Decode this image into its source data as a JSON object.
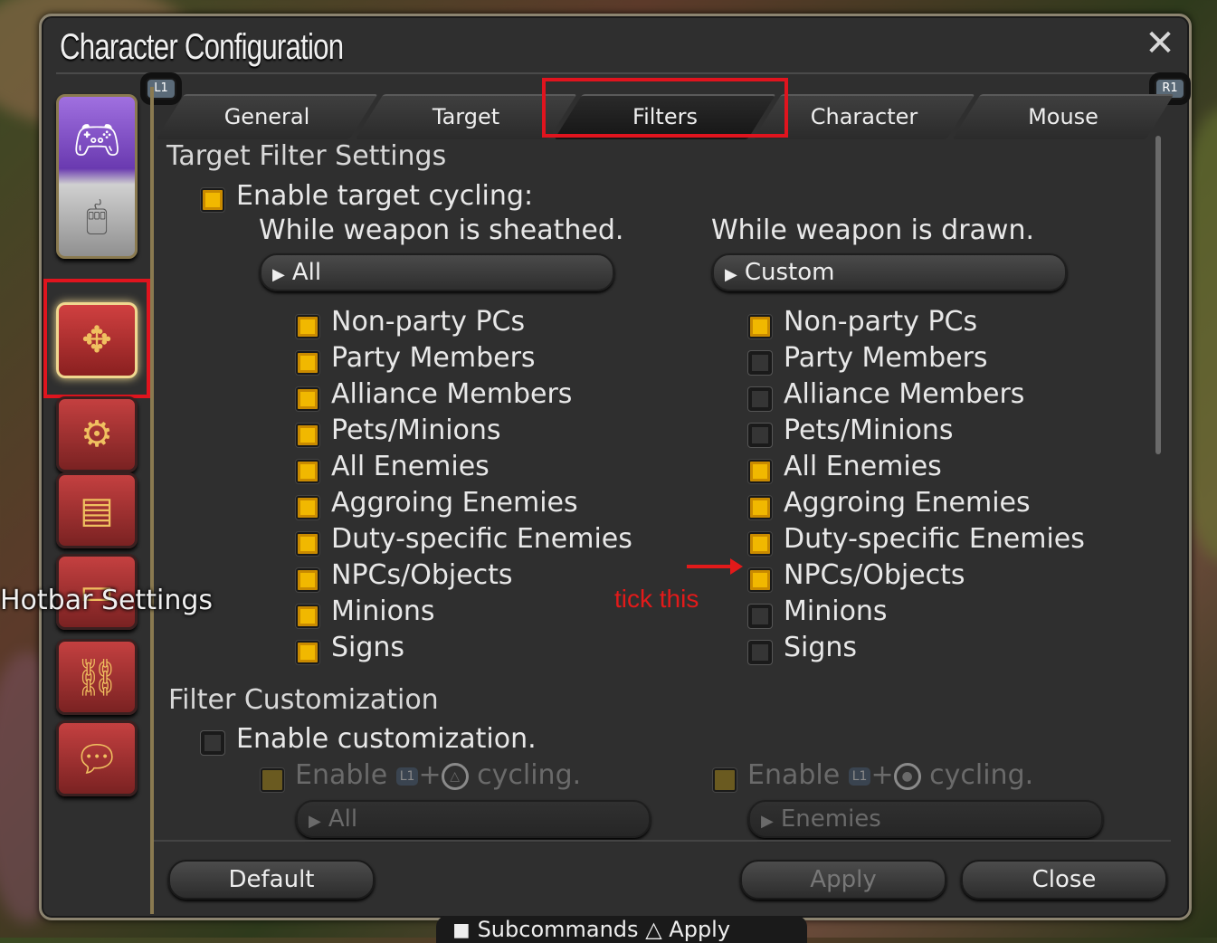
{
  "window": {
    "title": "Character Configuration",
    "close_icon": "close-x-icon"
  },
  "shoulder_buttons": {
    "left": "L1",
    "right": "R1"
  },
  "tabs": [
    {
      "label": "General"
    },
    {
      "label": "Target"
    },
    {
      "label": "Filters",
      "active": true
    },
    {
      "label": "Character"
    },
    {
      "label": "Mouse"
    }
  ],
  "sidebar": {
    "items": [
      {
        "name": "controller-mouse-toggle-icon"
      },
      {
        "name": "target-arrows-icon",
        "selected": true
      },
      {
        "name": "bag-gears-icon"
      },
      {
        "name": "id-card-icon"
      },
      {
        "name": "hotbar-icon",
        "tooltip": "Hotbar Settings"
      },
      {
        "name": "chain-icon"
      },
      {
        "name": "chat-bubble-icon"
      }
    ]
  },
  "target_filter": {
    "heading": "Target Filter Settings",
    "enable_label": "Enable target cycling:",
    "enable_checked": true,
    "sheathed": {
      "heading": "While weapon is sheathed.",
      "dropdown": "All",
      "options": [
        {
          "label": "Non-party PCs",
          "checked": true
        },
        {
          "label": "Party Members",
          "checked": true
        },
        {
          "label": "Alliance Members",
          "checked": true
        },
        {
          "label": "Pets/Minions",
          "checked": true
        },
        {
          "label": "All Enemies",
          "checked": true
        },
        {
          "label": "Aggroing Enemies",
          "checked": true
        },
        {
          "label": "Duty-specific Enemies",
          "checked": true
        },
        {
          "label": "NPCs/Objects",
          "checked": true
        },
        {
          "label": "Minions",
          "checked": true
        },
        {
          "label": "Signs",
          "checked": true
        }
      ]
    },
    "drawn": {
      "heading": "While weapon is drawn.",
      "dropdown": "Custom",
      "options": [
        {
          "label": "Non-party PCs",
          "checked": true
        },
        {
          "label": "Party Members",
          "checked": false
        },
        {
          "label": "Alliance Members",
          "checked": false
        },
        {
          "label": "Pets/Minions",
          "checked": false
        },
        {
          "label": "All Enemies",
          "checked": true
        },
        {
          "label": "Aggroing Enemies",
          "checked": true
        },
        {
          "label": "Duty-specific Enemies",
          "checked": true
        },
        {
          "label": "NPCs/Objects",
          "checked": true
        },
        {
          "label": "Minions",
          "checked": false
        },
        {
          "label": "Signs",
          "checked": false
        }
      ]
    }
  },
  "filter_custom": {
    "heading": "Filter Customization",
    "enable_label": "Enable customization.",
    "enable_checked": false,
    "left": {
      "prefix": "Enable",
      "badge": "L1",
      "plus": "+",
      "button_icon": "triangle-button-icon",
      "suffix": "cycling.",
      "dropdown": "All"
    },
    "right": {
      "prefix": "Enable",
      "badge": "L1",
      "plus": "+",
      "button_icon": "circle-button-icon",
      "suffix": "cycling.",
      "dropdown": "Enemies"
    }
  },
  "annotation": {
    "text": "tick this"
  },
  "footer": {
    "default": "Default",
    "apply": "Apply",
    "close": "Close"
  },
  "subcommand_bar": {
    "subcommands": "Subcommands",
    "apply": "Apply"
  },
  "colors": {
    "checked": "#f1b800",
    "highlight_box": "#e0141e",
    "annotation": "#e21a1a"
  }
}
